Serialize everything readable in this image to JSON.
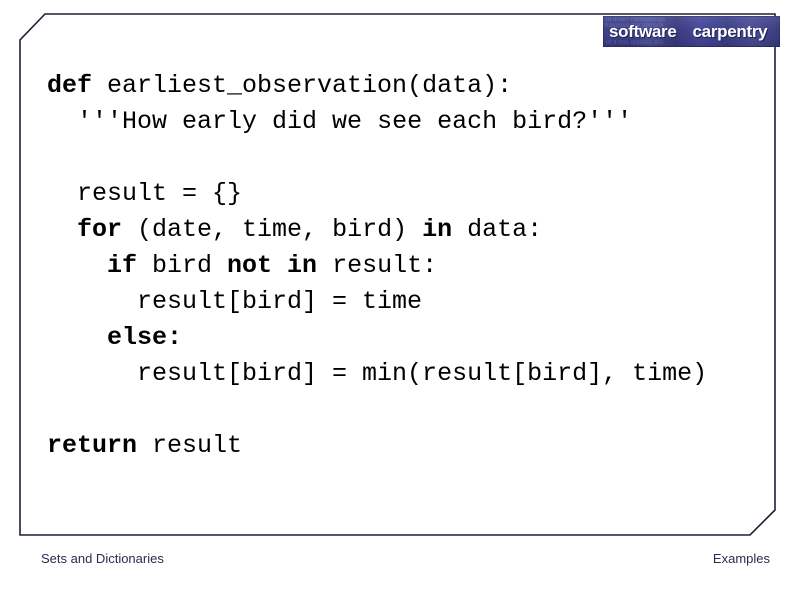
{
  "slide": {
    "border_color": "#2a1a38",
    "background_color": "#ffffff",
    "bevel_size": 26
  },
  "logo": {
    "name": "software-carpentry-logo",
    "word_one": "software",
    "word_two": "carpentry",
    "background_color": "#3b3d86",
    "text_color": "#ffffff",
    "texture_line_1": "of insert networkings",
    "texture_line_2": "nagoose the pecisior",
    "texture_line_3": "nt # doc creates alls"
  },
  "code": {
    "language": "python",
    "lines": [
      {
        "indent": 0,
        "segments": [
          {
            "text": "def ",
            "bold": true
          },
          {
            "text": "earliest_observation(data):",
            "bold": false
          }
        ]
      },
      {
        "indent": 1,
        "segments": [
          {
            "text": "'''How early did we see each bird?'''",
            "bold": false
          }
        ]
      },
      {
        "indent": 0,
        "segments": []
      },
      {
        "indent": 1,
        "segments": [
          {
            "text": "result = {}",
            "bold": false
          }
        ]
      },
      {
        "indent": 1,
        "segments": [
          {
            "text": "for ",
            "bold": true
          },
          {
            "text": "(date, time, bird) ",
            "bold": false
          },
          {
            "text": "in ",
            "bold": true
          },
          {
            "text": "data:",
            "bold": false
          }
        ]
      },
      {
        "indent": 2,
        "segments": [
          {
            "text": "if ",
            "bold": true
          },
          {
            "text": "bird ",
            "bold": false
          },
          {
            "text": "not in ",
            "bold": true
          },
          {
            "text": "result:",
            "bold": false
          }
        ]
      },
      {
        "indent": 3,
        "segments": [
          {
            "text": "result[bird] = time",
            "bold": false
          }
        ]
      },
      {
        "indent": 2,
        "segments": [
          {
            "text": "else:",
            "bold": true
          }
        ]
      },
      {
        "indent": 3,
        "segments": [
          {
            "text": "result[bird] = min(result[bird], time)",
            "bold": false
          }
        ]
      },
      {
        "indent": 0,
        "segments": []
      },
      {
        "indent": 0,
        "segments": [
          {
            "text": "return ",
            "bold": true
          },
          {
            "text": "result",
            "bold": false
          }
        ]
      }
    ]
  },
  "footer": {
    "left_label": "Sets and Dictionaries",
    "right_label": "Examples"
  }
}
